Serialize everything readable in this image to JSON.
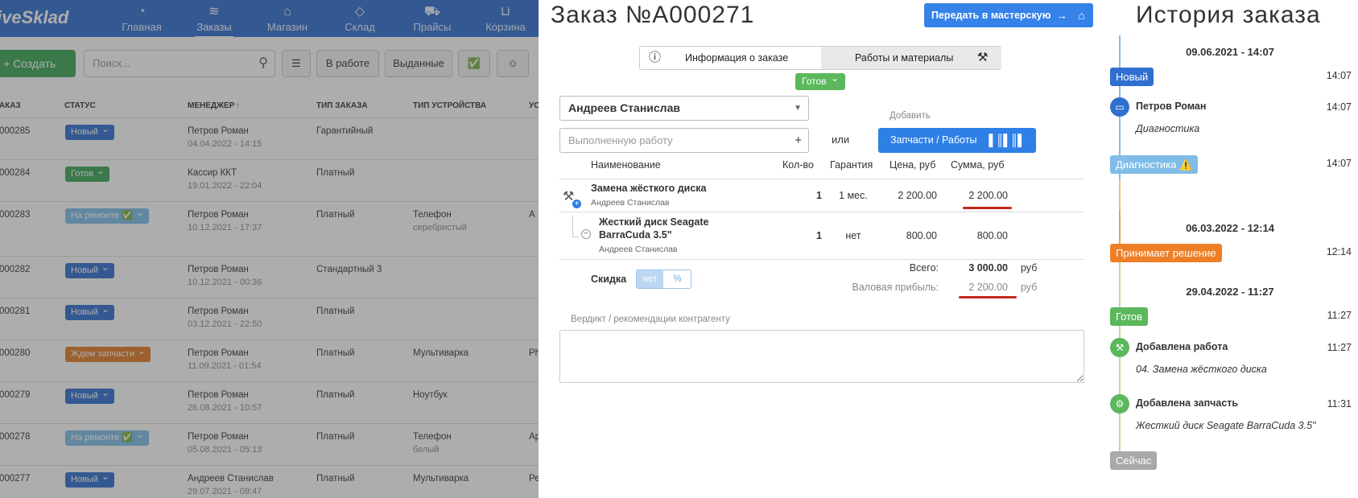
{
  "app": {
    "logo": "iveSklad"
  },
  "nav": [
    {
      "label": "Главная",
      "icon": "pie-chart-icon",
      "glyph": "◔"
    },
    {
      "label": "Заказы",
      "icon": "orders-icon",
      "glyph": "≋"
    },
    {
      "label": "Магазин",
      "icon": "bag-icon",
      "glyph": "⌂"
    },
    {
      "label": "Склад",
      "icon": "box-icon",
      "glyph": "◇"
    },
    {
      "label": "Прайсы",
      "icon": "truck-icon",
      "glyph": "⛟"
    },
    {
      "label": "Корзина",
      "icon": "cart-icon",
      "glyph": "⊔"
    }
  ],
  "toolbar": {
    "create": "+ Создать",
    "search_placeholder": "Поиск...",
    "in_work": "В работе",
    "issued": "Выданные",
    "check": "✅"
  },
  "table": {
    "headers": [
      "АКАЗ",
      "СТАТУС",
      "МЕНЕДЖЕР",
      "ТИП ЗАКАЗА",
      "ТИП УСТРОЙСТВА",
      "УС"
    ],
    "rows": [
      {
        "id": "000285",
        "status": "Новый",
        "color": "#2f6fd0",
        "manager": "Петров Роман",
        "date": "04.04.2022 - 14:15",
        "type": "Гарантийный",
        "device": "",
        "device_sub": "",
        "extra": ""
      },
      {
        "id": "000284",
        "status": "Готов",
        "color": "#3aa655",
        "manager": "Кассир ККТ",
        "date": "19.01.2022 - 22:04",
        "type": "Платный",
        "device": "",
        "device_sub": "",
        "extra": ""
      },
      {
        "id": "000283",
        "status": "На ремонте ✅",
        "color": "#7fbde8",
        "manager": "Петров Роман",
        "date": "10.12.2021 - 17:37",
        "type": "Платный",
        "device": "Телефон",
        "device_sub": "серебристый",
        "extra": "A"
      },
      {
        "id": "000282",
        "status": "Новый",
        "color": "#2f6fd0",
        "manager": "Петров Роман",
        "date": "10.12.2021 - 00:36",
        "type": "Стандартный 3",
        "device": "",
        "device_sub": "",
        "extra": ""
      },
      {
        "id": "000281",
        "status": "Новый",
        "color": "#2f6fd0",
        "manager": "Петров Роман",
        "date": "03.12.2021 - 22:50",
        "type": "Платный",
        "device": "",
        "device_sub": "",
        "extra": ""
      },
      {
        "id": "000280",
        "status": "Ждем запчасти",
        "color": "#e07a24",
        "manager": "Петров Роман",
        "date": "11.09.2021 - 01:54",
        "type": "Платный",
        "device": "Мультиварка",
        "device_sub": "",
        "extra": "Ph"
      },
      {
        "id": "000279",
        "status": "Новый",
        "color": "#2f6fd0",
        "manager": "Петров Роман",
        "date": "26.08.2021 - 10:57",
        "type": "Платный",
        "device": "Ноутбук",
        "device_sub": "",
        "extra": ""
      },
      {
        "id": "000278",
        "status": "На ремонте ✅",
        "color": "#7fbde8",
        "manager": "Петров Роман",
        "date": "05.08.2021 - 05:13",
        "type": "Платный",
        "device": "Телефон",
        "device_sub": "белый",
        "extra": "Ap"
      },
      {
        "id": "000277",
        "status": "Новый",
        "color": "#2f6fd0",
        "manager": "Андреев Станислав",
        "date": "29.07.2021 - 09:47",
        "type": "Платный",
        "device": "Мультиварка",
        "device_sub": "",
        "extra": "Ре"
      }
    ]
  },
  "order": {
    "title": "Заказ №A000271",
    "send_button": "Передать в мастерскую",
    "tab_info": "Информация о заказе",
    "tab_works": "Работы и материалы",
    "status": "Готов",
    "master": "Андреев Станислав",
    "add_label": "Добавить",
    "work_placeholder": "Выполненную работу",
    "or": "или",
    "parts_button": "Запчасти / Работы",
    "columns": {
      "name": "Наименование",
      "qty": "Кол-во",
      "warranty": "Гарантия",
      "price": "Цена, руб",
      "sum": "Сумма, руб"
    },
    "items": [
      {
        "name": "Замена жёсткого диска",
        "name2": "",
        "person": "Андреев Станислав",
        "qty": "1",
        "warranty": "1 мес.",
        "price": "2 200.00",
        "sum": "2 200.00"
      },
      {
        "name": "Жесткий диск Seagate",
        "name2": "BarraCuda 3.5\"",
        "person": "Андреев Станислав",
        "qty": "1",
        "warranty": "нет",
        "price": "800.00",
        "sum": "800.00"
      }
    ],
    "total_label": "Всего:",
    "total": "3 000.00",
    "profit_label": "Валовая прибыль:",
    "profit": "2 200.00",
    "currency": "руб",
    "discount_label": "Скидка",
    "discount_no": "нет",
    "discount_pct": "%",
    "verdict_label": "Вердикт / рекомендации контрагенту"
  },
  "history": {
    "title": "История заказа",
    "date1": "09.06.2021 - 14:07",
    "new": "Новый",
    "t1": "14:07",
    "person1": "Петров Роман",
    "t2": "14:07",
    "note1": "Диагностика",
    "diag": "Диагностика ⚠️",
    "t3": "14:07",
    "date2": "06.03.2022 - 12:14",
    "decision": "Принимает решение",
    "t4": "12:14",
    "date3": "29.04.2022 - 11:27",
    "ready": "Готов",
    "t5": "11:27",
    "work_added": "Добавлена работа",
    "t6": "11:27",
    "work_note": "04. Замена жёсткого диска",
    "part_added": "Добавлена запчасть",
    "t7": "11:31",
    "part_note": "Жесткий диск Seagate BarraCuda 3.5\"",
    "now": "Сейчас"
  }
}
